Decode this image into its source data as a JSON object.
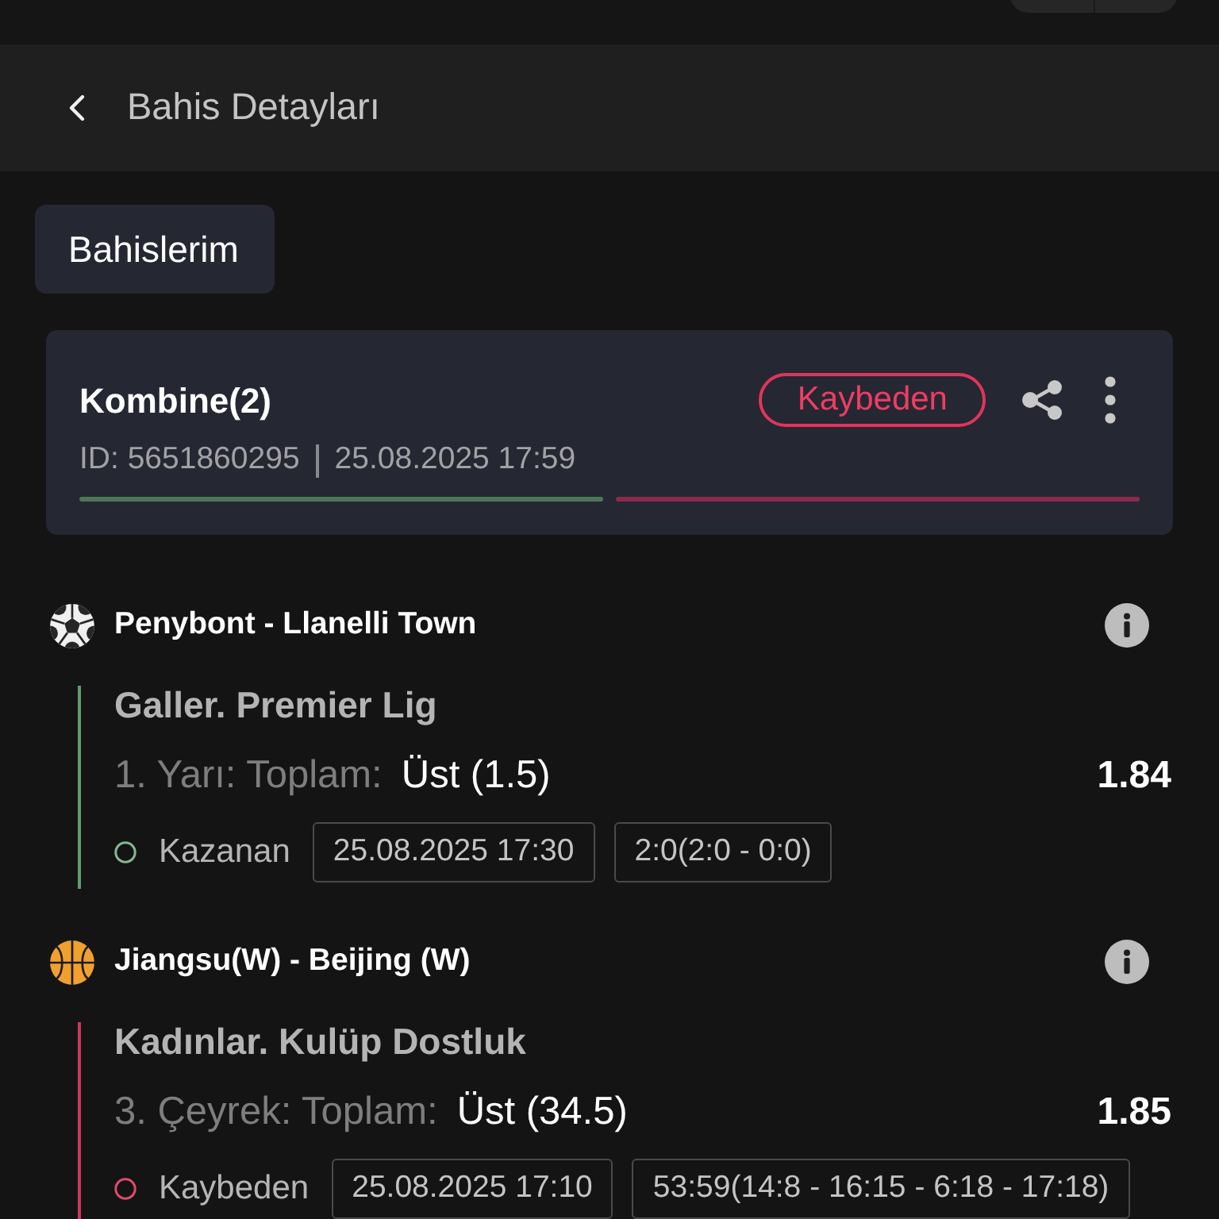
{
  "header": {
    "title": "Bahis Detayları"
  },
  "my_bets_button": {
    "label": "Bahislerim"
  },
  "bet": {
    "type": "Kombine(2)",
    "status": {
      "label": "Kaybeden",
      "kind": "lost"
    },
    "id": "ID: 5651860295",
    "placed_at": "25.08.2025 17:59"
  },
  "legs": [
    {
      "kind": "soccer",
      "match": "Penybont - Llanelli Town",
      "league": "Galler. Premier Lig",
      "market": "1. Yarı: Toplam:",
      "selection": "Üst (1.5)",
      "odds": "1.84",
      "result": {
        "kind": "won",
        "label": "Kazanan"
      },
      "start": "25.08.2025 17:30",
      "score": "2:0(2:0 - 0:0)"
    },
    {
      "kind": "basketball",
      "match": "Jiangsu(W) - Beijing (W)",
      "league": "Kadınlar. Kulüp Dostluk",
      "market": "3. Çeyrek: Toplam:",
      "selection": "Üst (34.5)",
      "odds": "1.85",
      "result": {
        "kind": "lost",
        "label": "Kaybeden"
      },
      "start": "25.08.2025 17:10",
      "score": "53:59(14:8 - 16:15 - 6:18 - 17:18)"
    }
  ]
}
